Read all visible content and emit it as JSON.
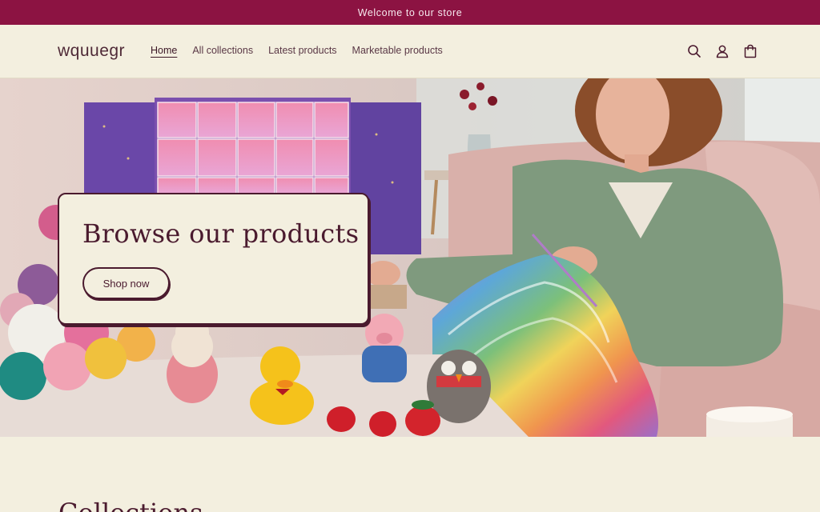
{
  "announcement": {
    "text": "Welcome to our store"
  },
  "header": {
    "logo": "wquuegr",
    "nav": [
      {
        "label": "Home",
        "active": true
      },
      {
        "label": "All collections",
        "active": false
      },
      {
        "label": "Latest products",
        "active": false
      },
      {
        "label": "Marketable products",
        "active": false
      }
    ],
    "icons": [
      "search-icon",
      "account-icon",
      "cart-icon"
    ]
  },
  "hero": {
    "heading": "Browse our products",
    "button_label": "Shop now",
    "image_description_icons": [
      "advent-calendar",
      "yarn-balls",
      "crochet-toys",
      "knitting-woman"
    ]
  },
  "section": {
    "title": "Collections"
  },
  "colors": {
    "announcement_bg": "#8c1342",
    "page_bg": "#f3efdf",
    "text": "#4a1a2e"
  }
}
